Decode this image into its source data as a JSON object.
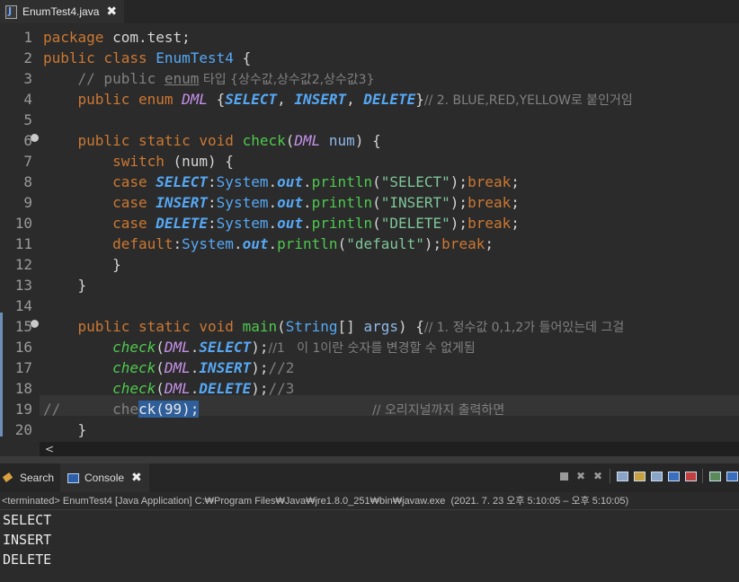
{
  "editor": {
    "tab_title": "EnumTest4.java",
    "close_glyph": "✖",
    "line_numbers": [
      "1",
      "2",
      "3",
      "4",
      "5",
      "6",
      "7",
      "8",
      "9",
      "10",
      "11",
      "12",
      "13",
      "14",
      "15",
      "16",
      "17",
      "18",
      "19",
      "20"
    ]
  },
  "code": {
    "l1_kw": "package",
    "l1_rest": " com.test;",
    "l2_kw": "public class ",
    "l2_name": "EnumTest4",
    "l2_rest": " {",
    "l3_comment_a": "    // public ",
    "l3_comment_enum": "enum",
    "l3_comment_b": " 타입 {상수값,상수값2,상수값3}",
    "l4_kw": "    public enum ",
    "l4_name": "DML",
    "l4_open": " {",
    "l4_c1": "SELECT",
    "l4_sep1": ", ",
    "l4_c2": "INSERT",
    "l4_sep2": ", ",
    "l4_c3": "DELETE",
    "l4_close": "}",
    "l4_comment": "// 2. BLUE,RED,YELLOW로 붙인거임",
    "l6_kw": "    public static void ",
    "l6_fn": "check",
    "l6_p1": "(",
    "l6_type": "DML",
    "l6_param": " num",
    "l6_p2": ") {",
    "l7_kw": "        switch",
    "l7_rest": " (num) {",
    "case_kw": "        case ",
    "c_select": "SELECT",
    "c_insert": "INSERT",
    "c_delete": "DELETE",
    "colon": ":",
    "sys": "System",
    "dot": ".",
    "out": "out",
    "println": "println",
    "open_paren": "(",
    "s_select": "\"SELECT\"",
    "s_insert": "\"INSERT\"",
    "s_delete": "\"DELETE\"",
    "s_default": "\"default\"",
    "close_semi": ");",
    "brk": "break",
    "semi": ";",
    "l11_kw": "        default",
    "l12": "        }",
    "l13": "    }",
    "l15_kw": "    public static void ",
    "l15_fn": "main",
    "l15_p1": "(",
    "l15_type": "String",
    "l15_arr": "[] ",
    "l15_param": "args",
    "l15_p2": ") {",
    "l15_comment": "// 1. 정수값 0,1,2가 들어있는데 그걸",
    "indent8": "        ",
    "call_check": "check",
    "dml": "DML",
    "call_close": ");",
    "l16_comment": "//1   이 1이란 숫자를 변경할 수 없게됨",
    "l17_comment": "//2",
    "l18_comment": "//3",
    "l19_prefix": "//      ",
    "l19_pre": "che",
    "l19_sel": "ck(99);",
    "l19_pad": "                    ",
    "l19_comment": "// 오리지널까지 출력하면",
    "l20": "    }"
  },
  "hscroll": {
    "left_arrow": "<"
  },
  "views": {
    "search_label": "Search",
    "console_label": "Console",
    "console_close": "✖"
  },
  "console": {
    "status": "<terminated> EnumTest4 [Java Application] C:₩Program Files₩Java₩jre1.8.0_251₩bin₩javaw.exe  (2021. 7. 23 오후 5:10:05 – 오후 5:10:05)",
    "output": [
      "SELECT",
      "INSERT",
      "DELETE"
    ]
  },
  "colors": {
    "keyword": "#cc7832",
    "type": "#56a8f5",
    "method": "#4ec94e",
    "string": "#7ec699",
    "comment": "#808080",
    "selection": "#2f5f9a"
  }
}
